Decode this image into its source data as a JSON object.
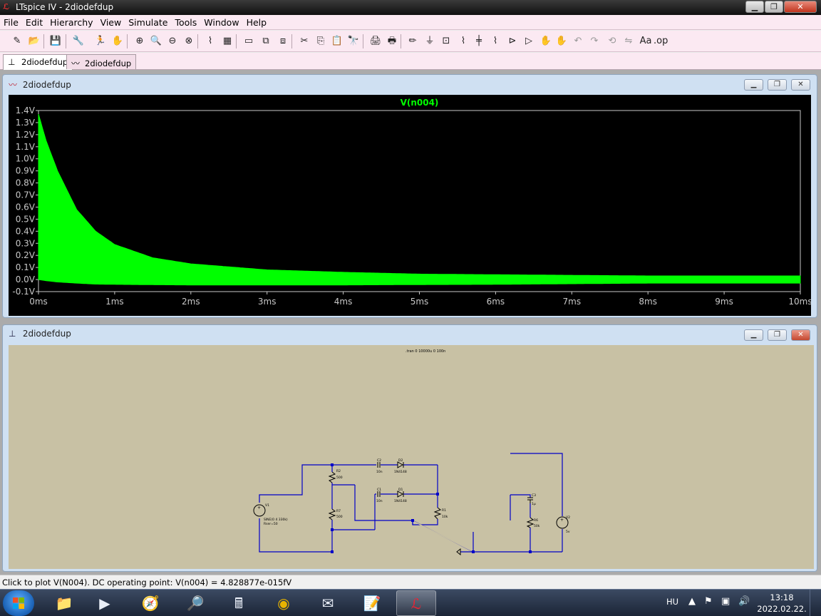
{
  "window": {
    "title": "LTspice IV - 2diodefdup",
    "app_icon": "ltspice-logo-icon",
    "buttons": {
      "minimize": "▁",
      "maximize": "❐",
      "close": "✕"
    }
  },
  "menu": [
    "File",
    "Edit",
    "Hierarchy",
    "View",
    "Simulate",
    "Tools",
    "Window",
    "Help"
  ],
  "toolbar": {
    "icons": [
      "new-schematic-icon",
      "open-icon",
      "save-icon",
      "control-panel-icon",
      "run-icon",
      "halt-icon",
      "zoom-in-icon",
      "zoom-pan-icon",
      "zoom-out-icon",
      "zoom-fit-icon",
      "autorange-icon",
      "grid-icon",
      "tile-horizontal-icon",
      "cascade-icon",
      "tile-vertical-icon",
      "cut-icon",
      "copy-icon",
      "paste-icon",
      "find-icon",
      "print-setup-icon",
      "print-icon",
      "wire-icon",
      "ground-icon",
      "label-icon",
      "resistor-icon",
      "capacitor-icon",
      "inductor-icon",
      "diode-icon",
      "component-icon",
      "move-icon",
      "drag-icon",
      "undo-icon",
      "redo-icon",
      "rotate-icon",
      "mirror-icon",
      "text-icon",
      "spice-directive-icon"
    ],
    "glyphs": [
      "✎",
      "📂",
      "💾",
      "🔧",
      "🏃",
      "✋",
      "⊕",
      "🔍",
      "⊖",
      "⊗",
      "⌇",
      "▦",
      "▭",
      "⧉",
      "⧈",
      "✂",
      "⎘",
      "📋",
      "🔭",
      "🖨",
      "🖶",
      "✏",
      "⏚",
      "⊡",
      "⌇",
      "╪",
      "⌇",
      "⊳",
      "▷",
      "✋",
      "✋",
      "↶",
      "↷",
      "⟲",
      "⇋",
      "Aa",
      ".op"
    ]
  },
  "tabs": [
    {
      "label": "2diodefdup",
      "icon": "schematic-tab-icon",
      "glyph": "⊥",
      "active": true
    },
    {
      "label": "2diodefdup",
      "icon": "waveform-tab-icon",
      "glyph": "〰",
      "active": false
    }
  ],
  "waveform_window": {
    "title": "2diodefdup",
    "icon": "waveform-window-icon",
    "trace_label": "V(n004)",
    "trace_color": "#00ff00",
    "axis_color": "#c8c8c8"
  },
  "chart_data": {
    "type": "area",
    "title": "V(n004)",
    "xlabel": "",
    "ylabel": "",
    "x_ticks": [
      "0ms",
      "1ms",
      "2ms",
      "3ms",
      "4ms",
      "5ms",
      "6ms",
      "7ms",
      "8ms",
      "9ms",
      "10ms"
    ],
    "y_ticks": [
      "1.4V",
      "1.3V",
      "1.2V",
      "1.1V",
      "1.0V",
      "0.9V",
      "0.8V",
      "0.7V",
      "0.6V",
      "0.5V",
      "0.4V",
      "0.3V",
      "0.2V",
      "0.1V",
      "0.0V",
      "-0.1V"
    ],
    "xlim": [
      0,
      10
    ],
    "ylim": [
      -0.1,
      1.4
    ],
    "series": [
      {
        "color": "#00ff00",
        "x_ms": [
          0,
          0.1,
          0.25,
          0.5,
          0.75,
          1,
          1.5,
          2,
          3,
          4,
          5,
          6,
          7,
          8,
          9,
          10
        ],
        "upper_v": [
          1.37,
          1.15,
          0.9,
          0.58,
          0.4,
          0.29,
          0.18,
          0.13,
          0.08,
          0.06,
          0.045,
          0.04,
          0.035,
          0.03,
          0.03,
          0.03
        ],
        "lower_v": [
          0.0,
          -0.01,
          -0.02,
          -0.03,
          -0.038,
          -0.04,
          -0.043,
          -0.045,
          -0.045,
          -0.045,
          -0.042,
          -0.04,
          -0.035,
          -0.03,
          -0.03,
          -0.03
        ]
      }
    ],
    "grid": false,
    "background": "#000000"
  },
  "schematic_window": {
    "title": "2diodefdup",
    "icon": "schematic-window-icon",
    "directive": ".tran 0 10000u 0 100n",
    "wire_color": "#0000c8",
    "background": "#c8c1a4",
    "labels": {
      "v1": "V1",
      "v1_value": "SINE(0 4 330k)",
      "v1_rser": "Rser=50",
      "r2": "R2",
      "r2_val": "500",
      "r7": "R7",
      "r7_val": "500",
      "c2": "C2",
      "c2_val": "10n",
      "c1": "C1",
      "c1_val": "10n",
      "d2": "D2",
      "d2_val": "1N4148",
      "d1": "D1",
      "d1_val": "1N4148",
      "r1": "R1",
      "r1_val": "10k",
      "c3": "C3",
      "c3_val": "1µ",
      "r6": "R6",
      "r6_val": "50k",
      "v2": "V2",
      "v2_val": "5v"
    }
  },
  "status": "Click to plot V(N004).  DC operating point: V(n004) = 4.828877e-015fV",
  "taskbar": {
    "apps": [
      {
        "name": "explorer-icon",
        "glyph": "📁"
      },
      {
        "name": "media-player-icon",
        "glyph": "▶"
      },
      {
        "name": "safari-icon",
        "glyph": "🧭"
      },
      {
        "name": "search-files-icon",
        "glyph": "🔎"
      },
      {
        "name": "calculator-icon",
        "glyph": "🖩"
      },
      {
        "name": "chrome-icon",
        "glyph": "◉"
      },
      {
        "name": "mail-icon",
        "glyph": "✉"
      },
      {
        "name": "notepad-icon",
        "glyph": "📝"
      },
      {
        "name": "ltspice-taskbar-icon",
        "glyph": "ℒ"
      }
    ],
    "language": "HU",
    "time": "13:18",
    "date": "2022.02.22."
  }
}
